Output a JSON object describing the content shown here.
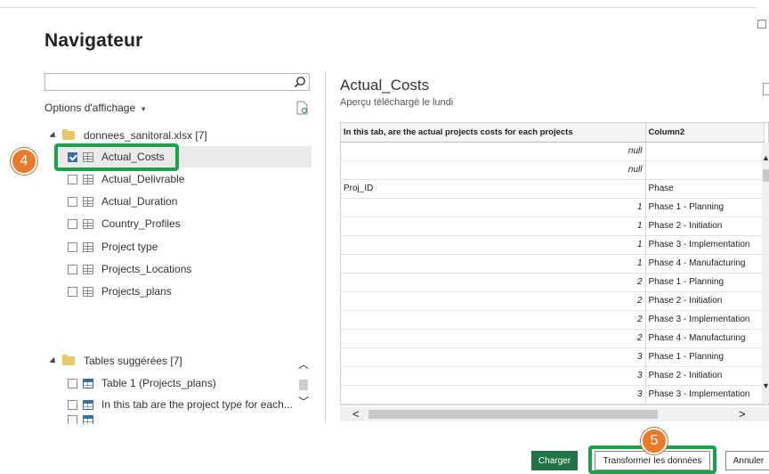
{
  "window": {
    "title": "Navigateur"
  },
  "search": {
    "value": "",
    "placeholder": ""
  },
  "options": {
    "label": "Options d'affichage"
  },
  "tree": {
    "file": {
      "label": "donnees_sanitoral.xlsx [7]"
    },
    "items": [
      {
        "label": "Actual_Costs",
        "checked": true
      },
      {
        "label": "Actual_Delivrable",
        "checked": false
      },
      {
        "label": "Actual_Duration",
        "checked": false
      },
      {
        "label": "Country_Profiles",
        "checked": false
      },
      {
        "label": "Project type",
        "checked": false
      },
      {
        "label": "Projects_Locations",
        "checked": false
      },
      {
        "label": "Projects_plans",
        "checked": false
      }
    ],
    "suggested": {
      "label": "Tables suggérées [7]",
      "items": [
        {
          "label": "Table 1 (Projects_plans)",
          "checked": false
        },
        {
          "label": "In this tab are the project type for each...",
          "checked": false
        }
      ]
    }
  },
  "annotations": {
    "step4": "4",
    "step5": "5"
  },
  "preview": {
    "title": "Actual_Costs",
    "subtitle": "Aperçu téléchargé le lundi",
    "columns": [
      "In this tab, are the actual projects costs for each projects",
      "Column2"
    ],
    "rows": [
      [
        "null",
        ""
      ],
      [
        "null",
        ""
      ],
      [
        "Proj_ID",
        "Phase"
      ],
      [
        "1",
        "Phase 1 - Planning"
      ],
      [
        "1",
        "Phase 2 - Initiation"
      ],
      [
        "1",
        "Phase 3 - Implementation"
      ],
      [
        "1",
        "Phase 4 - Manufacturing"
      ],
      [
        "2",
        "Phase 1 - Planning"
      ],
      [
        "2",
        "Phase 2 - Initiation"
      ],
      [
        "2",
        "Phase 3 - Implementation"
      ],
      [
        "2",
        "Phase 4 - Manufacturing"
      ],
      [
        "3",
        "Phase 1 - Planning"
      ],
      [
        "3",
        "Phase 2 - Initiation"
      ],
      [
        "3",
        "Phase 3 - Implementation"
      ]
    ]
  },
  "buttons": {
    "load": "Charger",
    "transform": "Transformer les données",
    "cancel": "Annuler"
  },
  "colors": {
    "accent_green": "#1aa34a",
    "badge_orange": "#e87a2a",
    "load_button": "#217346"
  }
}
